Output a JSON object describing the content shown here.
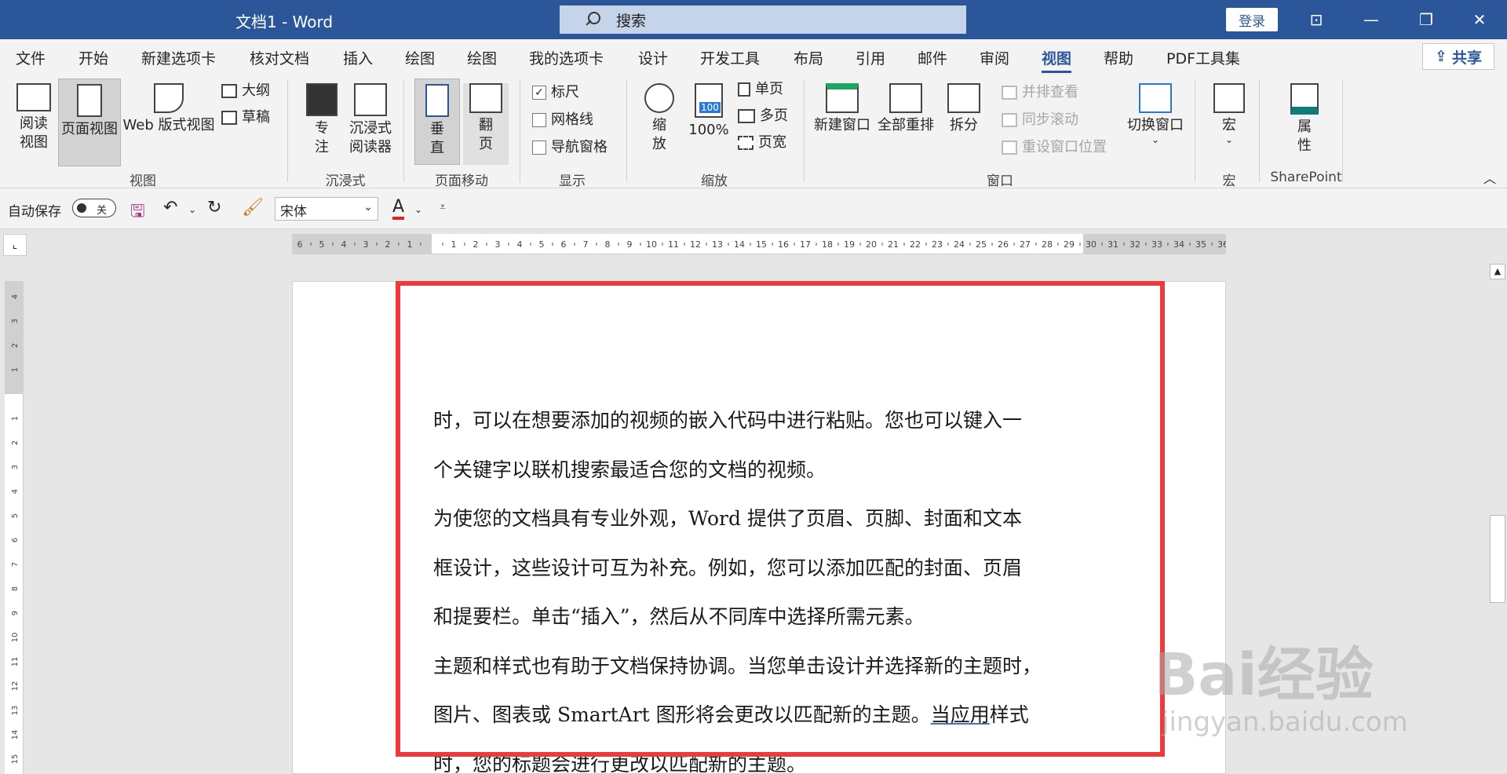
{
  "titlebar": {
    "doc_title": "文档1  -  Word",
    "search_placeholder": "搜索",
    "login": "登录"
  },
  "tabs": [
    "文件",
    "开始",
    "新建选项卡",
    "核对文档",
    "插入",
    "绘图",
    "绘图",
    "我的选项卡",
    "设计",
    "开发工具",
    "布局",
    "引用",
    "邮件",
    "审阅",
    "视图",
    "帮助",
    "PDF工具集"
  ],
  "active_tab": "视图",
  "share": "共享",
  "ribbon": {
    "view": {
      "read_mode_1": "阅读",
      "read_mode_2": "视图",
      "print_layout": "页面视图",
      "web_layout": "Web 版式视图",
      "outline": "大纲",
      "draft": "草稿",
      "label": "视图"
    },
    "immersive": {
      "focus_1": "专",
      "focus_2": "注",
      "reader_1": "沉浸式",
      "reader_2": "阅读器",
      "label": "沉浸式"
    },
    "page_move": {
      "vertical_1": "垂",
      "vertical_2": "直",
      "side_1": "翻",
      "side_2": "页",
      "label": "页面移动"
    },
    "show": {
      "ruler": "标尺",
      "ruler_checked": "✓",
      "gridlines": "网格线",
      "nav_pane": "导航窗格",
      "label": "显示"
    },
    "zoom": {
      "zoom_1": "缩",
      "zoom_2": "放",
      "hundred": "100%",
      "hundred_icon": "100",
      "one_page": "单页",
      "multi_page": "多页",
      "page_width": "页宽",
      "label": "缩放"
    },
    "window": {
      "new_window": "新建窗口",
      "arrange_all": "全部重排",
      "split": "拆分",
      "side_by_side": "并排查看",
      "sync_scroll": "同步滚动",
      "reset_pos": "重设窗口位置",
      "switch_window": "切换窗口",
      "label": "窗口"
    },
    "macros": {
      "macros": "宏",
      "label": "宏"
    },
    "sharepoint": {
      "props_1": "属",
      "props_2": "性",
      "label": "SharePoint"
    }
  },
  "qat": {
    "autosave": "自动保存",
    "toggle": "关",
    "font": "宋体"
  },
  "document": {
    "lines": [
      "时，可以在想要添加的视频的嵌入代码中进行粘贴。您也可以键入一",
      "个关键字以联机搜索最适合您的文档的视频。",
      "为使您的文档具有专业外观，Word 提供了页眉、页脚、封面和文本",
      "框设计，这些设计可互为补充。例如，您可以添加匹配的封面、页眉",
      "和提要栏。单击“插入”，然后从不同库中选择所需元素。",
      "主题和样式也有助于文档保持协调。当您单击设计并选择新的主题时，",
      "时，您的标题会进行更改以匹配新的主题。"
    ],
    "line7_a": "图片、图表或 SmartArt 图形将会更改以匹配新的主题。",
    "line7_b": "当应用",
    "line7_c": "样式"
  },
  "watermark": {
    "text": "Bai经验",
    "url": "jingyan.baidu.com"
  },
  "colors": {
    "titlebar": "#2b579a",
    "highlight": "#ec3b3d"
  }
}
